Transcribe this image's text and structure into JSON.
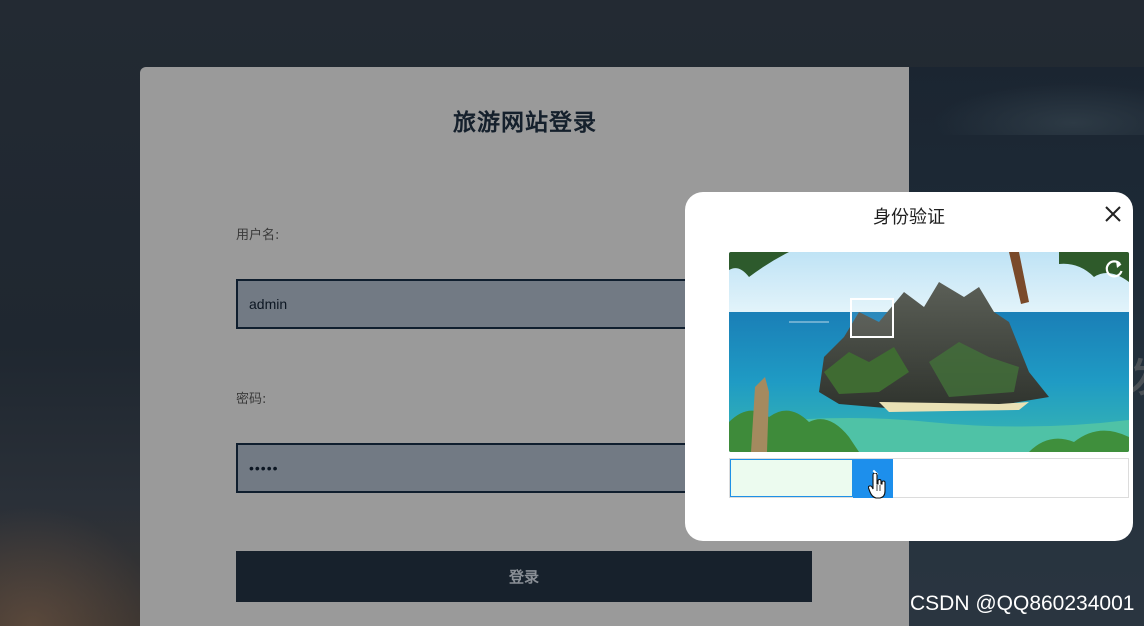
{
  "login": {
    "title": "旅游网站登录",
    "username_label": "用户名:",
    "username_value": "admin",
    "password_label": "密码:",
    "password_value": "•••••",
    "submit_label": "登录"
  },
  "right_panel": {
    "glyph": "发"
  },
  "verify": {
    "title": "身份验证",
    "close_icon": "close-icon",
    "refresh_icon": "refresh-icon",
    "slider_progress": 0.31,
    "accent_color": "#1d8fec"
  },
  "watermark": "CSDN @QQ860234001",
  "colors": {
    "card_bg": "#9a9a9a",
    "input_border": "#0f1e2e",
    "button_bg": "#17212c",
    "slider_handle": "#1d8fec"
  }
}
